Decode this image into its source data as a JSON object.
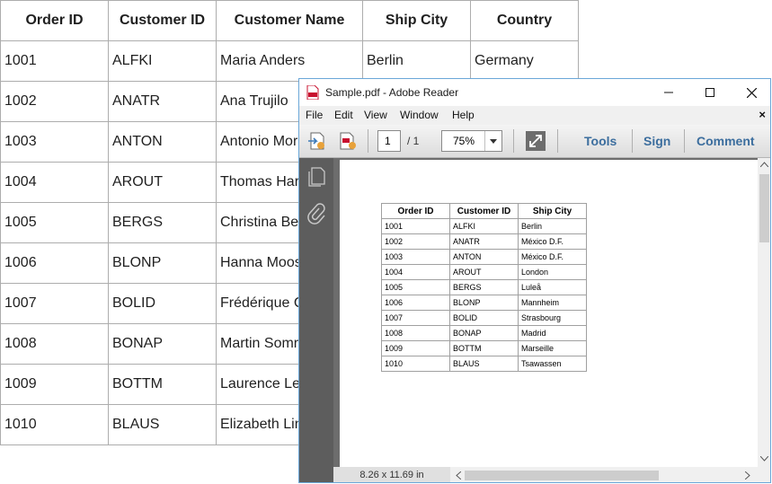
{
  "grid": {
    "headers": [
      "Order ID",
      "Customer ID",
      "Customer Name",
      "Ship City",
      "Country"
    ],
    "rows": [
      [
        "1001",
        "ALFKI",
        "Maria Anders",
        "Berlin",
        "Germany"
      ],
      [
        "1002",
        "ANATR",
        "Ana Trujilo",
        "",
        ""
      ],
      [
        "1003",
        "ANTON",
        "Antonio Mor",
        "",
        ""
      ],
      [
        "1004",
        "AROUT",
        "Thomas Harc",
        "",
        ""
      ],
      [
        "1005",
        "BERGS",
        "Christina Ber",
        "",
        ""
      ],
      [
        "1006",
        "BLONP",
        "Hanna Moos",
        "",
        ""
      ],
      [
        "1007",
        "BOLID",
        "Frédérique C",
        "",
        ""
      ],
      [
        "1008",
        "BONAP",
        "Martin Somr",
        "",
        ""
      ],
      [
        "1009",
        "BOTTM",
        "Laurence Leb",
        "",
        ""
      ],
      [
        "1010",
        "BLAUS",
        "Elizabeth Lin",
        "",
        ""
      ]
    ]
  },
  "reader": {
    "title": "Sample.pdf - Adobe Reader",
    "menu": [
      "File",
      "Edit",
      "View",
      "Window",
      "Help"
    ],
    "menu_close": "×",
    "page_current": "1",
    "page_total": "/ 1",
    "zoom": "75%",
    "tools_label": "Tools",
    "sign_label": "Sign",
    "comment_label": "Comment",
    "page_size": "8.26 x 11.69 in"
  },
  "pdf_table": {
    "headers": [
      "Order ID",
      "Customer ID",
      "Ship City"
    ],
    "rows": [
      [
        "1001",
        "ALFKI",
        "Berlin"
      ],
      [
        "1002",
        "ANATR",
        "México D.F."
      ],
      [
        "1003",
        "ANTON",
        "México D.F."
      ],
      [
        "1004",
        "AROUT",
        "London"
      ],
      [
        "1005",
        "BERGS",
        "Luleå"
      ],
      [
        "1006",
        "BLONP",
        "Mannheim"
      ],
      [
        "1007",
        "BOLID",
        "Strasbourg"
      ],
      [
        "1008",
        "BONAP",
        "Madrid"
      ],
      [
        "1009",
        "BOTTM",
        "Marseille"
      ],
      [
        "1010",
        "BLAUS",
        "Tsawassen"
      ]
    ]
  },
  "colors": {
    "link": "#3c6e9e",
    "nav_pane": "#5d5d5d",
    "doc_bg": "#6d6d6d",
    "pdf_red": "#c8102e"
  }
}
